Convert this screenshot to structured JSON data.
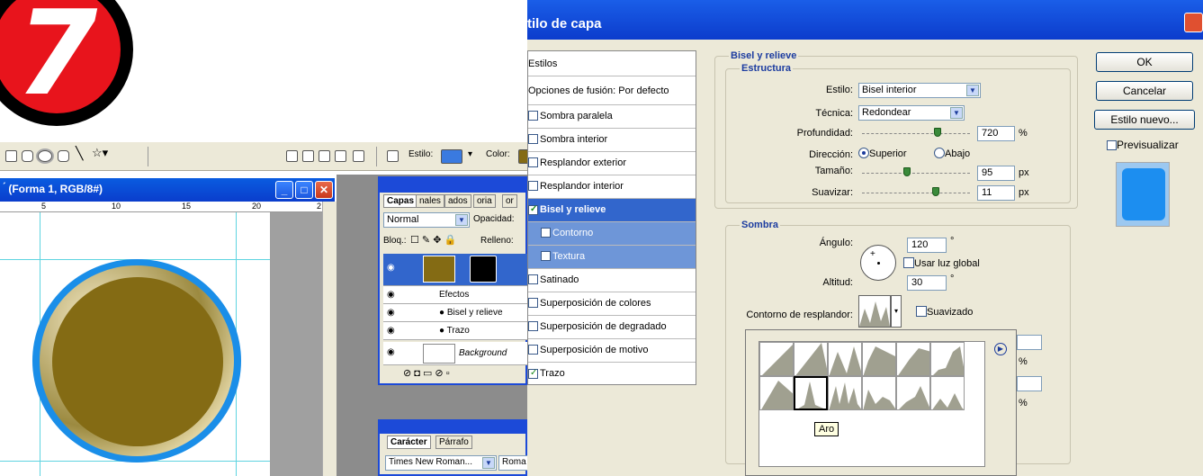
{
  "badge": {
    "number": "7"
  },
  "toolbar": {
    "style_label": "Estilo:",
    "color_label": "Color:"
  },
  "document": {
    "title": "́ (Forma 1, RGB/8#)",
    "ruler_ticks": [
      "5",
      "10",
      "15",
      "20",
      "2"
    ]
  },
  "layers_panel": {
    "tabs": [
      "Capas",
      "nales",
      "ados",
      "oria",
      "or"
    ],
    "blend_mode": "Normal",
    "opacity_label": "Opacidad:",
    "lock_label": "Bloq.:",
    "fill_label": "Relleno:",
    "effects_label": "Efectos",
    "effect_items": [
      "Bisel y relieve",
      "Trazo"
    ],
    "background_label": "Background"
  },
  "char_panel": {
    "tabs": [
      "Carácter",
      "Párrafo"
    ],
    "font": "Times New Roman...",
    "style": "Roma"
  },
  "dialog": {
    "title": "tilo de capa",
    "styles_header": "Estilos",
    "blend_options": "Opciones de fusión: Por defecto",
    "styles": [
      {
        "label": "Sombra paralela",
        "checked": false
      },
      {
        "label": "Sombra interior",
        "checked": false
      },
      {
        "label": "Resplandor exterior",
        "checked": false
      },
      {
        "label": "Resplandor interior",
        "checked": false
      },
      {
        "label": "Bisel y relieve",
        "checked": true
      },
      {
        "label": "Contorno",
        "checked": false
      },
      {
        "label": "Textura",
        "checked": false
      },
      {
        "label": "Satinado",
        "checked": false
      },
      {
        "label": "Superposición de colores",
        "checked": false
      },
      {
        "label": "Superposición de degradado",
        "checked": false
      },
      {
        "label": "Superposición de motivo",
        "checked": false
      },
      {
        "label": "Trazo",
        "checked": true
      }
    ],
    "bevel": {
      "title": "Bisel y relieve",
      "structure_title": "Estructura",
      "style_label": "Estilo:",
      "style_value": "Bisel interior",
      "technique_label": "Técnica:",
      "technique_value": "Redondear",
      "depth_label": "Profundidad:",
      "depth_value": "720",
      "depth_unit": "%",
      "direction_label": "Dirección:",
      "dir_up": "Superior",
      "dir_down": "Abajo",
      "size_label": "Tamaño:",
      "size_value": "95",
      "size_unit": "px",
      "soften_label": "Suavizar:",
      "soften_value": "11",
      "soften_unit": "px"
    },
    "shading": {
      "title": "Sombra",
      "angle_label": "Ángulo:",
      "angle_value": "120",
      "angle_unit": "°",
      "global_light": "Usar luz global",
      "altitude_label": "Altitud:",
      "altitude_value": "30",
      "altitude_unit": "°",
      "gloss_label": "Contorno de resplandor:",
      "antialias_label": "Suavizado",
      "pct1": "%",
      "pct2": "%"
    },
    "picker_tooltip": "Aro",
    "buttons": {
      "ok": "OK",
      "cancel": "Cancelar",
      "new_style": "Estilo nuevo...",
      "preview": "Previsualizar"
    }
  }
}
